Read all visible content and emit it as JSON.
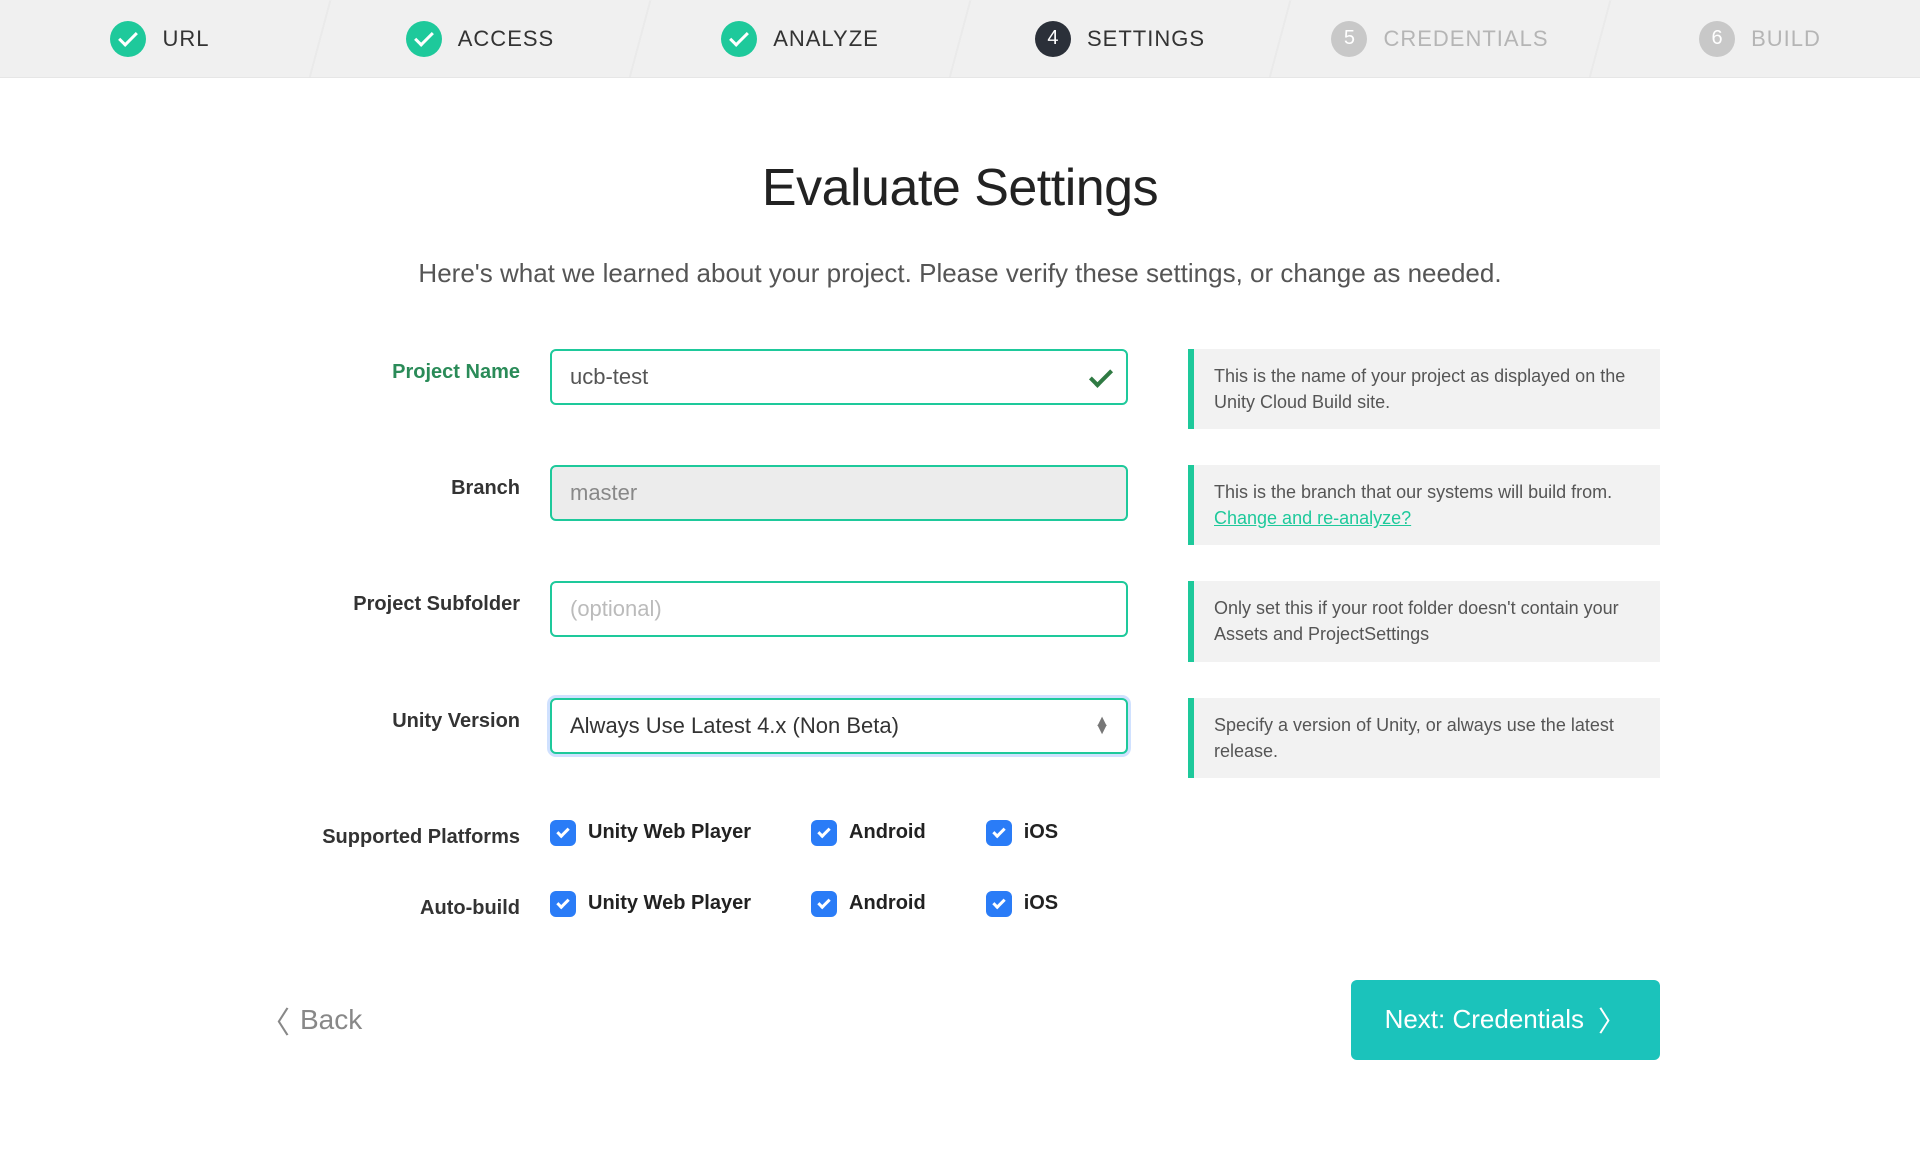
{
  "stepper": {
    "steps": [
      {
        "label": "URL",
        "state": "done"
      },
      {
        "label": "ACCESS",
        "state": "done"
      },
      {
        "label": "ANALYZE",
        "state": "done"
      },
      {
        "label": "SETTINGS",
        "state": "current",
        "number": "4"
      },
      {
        "label": "CREDENTIALS",
        "state": "future",
        "number": "5"
      },
      {
        "label": "BUILD",
        "state": "future",
        "number": "6"
      }
    ]
  },
  "page": {
    "title": "Evaluate Settings",
    "subtitle": "Here's what we learned about your project. Please verify these settings, or change as needed."
  },
  "form": {
    "projectName": {
      "label": "Project Name",
      "value": "ucb-test",
      "help": "This is the name of your project as displayed on the Unity Cloud Build site."
    },
    "branch": {
      "label": "Branch",
      "value": "master",
      "help": "This is the branch that our systems will build from.",
      "helpLink": "Change and re-analyze?"
    },
    "subfolder": {
      "label": "Project Subfolder",
      "value": "",
      "placeholder": "(optional)",
      "help": "Only set this if your root folder doesn't contain your Assets and ProjectSettings"
    },
    "unityVersion": {
      "label": "Unity Version",
      "value": "Always Use Latest 4.x (Non Beta)",
      "help": "Specify a version of Unity, or always use the latest release."
    },
    "supportedPlatforms": {
      "label": "Supported Platforms",
      "options": [
        {
          "label": "Unity Web Player",
          "checked": true
        },
        {
          "label": "Android",
          "checked": true
        },
        {
          "label": "iOS",
          "checked": true
        }
      ]
    },
    "autoBuild": {
      "label": "Auto-build",
      "options": [
        {
          "label": "Unity Web Player",
          "checked": true
        },
        {
          "label": "Android",
          "checked": true
        },
        {
          "label": "iOS",
          "checked": true
        }
      ]
    }
  },
  "nav": {
    "back": "Back",
    "next": "Next: Credentials"
  }
}
